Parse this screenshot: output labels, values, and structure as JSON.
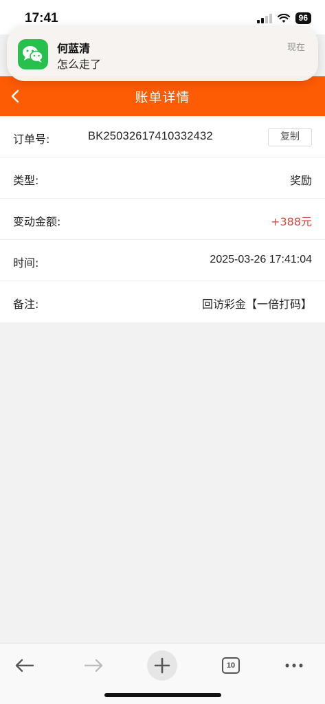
{
  "status_bar": {
    "time": "17:41",
    "battery": "96",
    "icons": [
      "signal-icon",
      "wifi-icon",
      "battery-icon"
    ]
  },
  "notification": {
    "app_icon": "wechat-icon",
    "sender": "何蓝清",
    "message": "怎么走了",
    "time": "现在"
  },
  "header": {
    "title": "账单详情",
    "back_icon": "chevron-left-icon"
  },
  "details": {
    "order_label": "订单号:",
    "order_value": "BK25032617410332432",
    "copy_label": "复制",
    "type_label": "类型:",
    "type_value": "奖励",
    "amount_label": "变动金额:",
    "amount_value": "+388元",
    "time_label": "时间:",
    "time_value": "2025-03-26 17:41:04",
    "note_label": "备注:",
    "note_value": "回访彩金【一倍打码】"
  },
  "toolbar": {
    "tabs_count": "10",
    "icons": [
      "arrow-left-icon",
      "arrow-right-icon",
      "plus-icon",
      "tabs-icon",
      "more-icon"
    ]
  },
  "colors": {
    "header_bg": "#fe5b05",
    "amount": "#d4493f",
    "wechat": "#27c04c",
    "page_bg": "#f2f2f2"
  }
}
